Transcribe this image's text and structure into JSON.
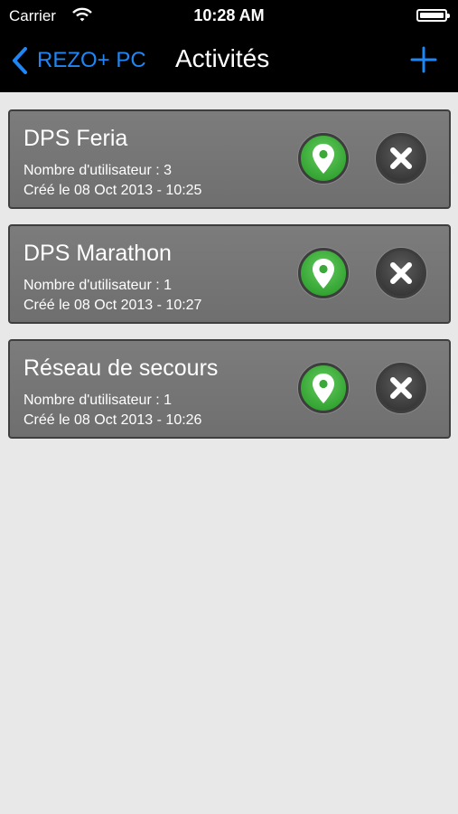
{
  "status_bar": {
    "carrier": "Carrier",
    "time": "10:28 AM",
    "icons": [
      "wifi-icon",
      "battery-icon"
    ]
  },
  "nav": {
    "back_label": "REZO+ PC",
    "title": "Activités",
    "accent_color": "#1e86f5",
    "icons": [
      "chevron-left-icon",
      "plus-icon"
    ]
  },
  "activities": [
    {
      "title": "DPS Feria",
      "users": "Nombre d'utilisateur : 3",
      "created": "Créé le 08 Oct 2013 - 10:25"
    },
    {
      "title": "DPS Marathon",
      "users": "Nombre d'utilisateur : 1",
      "created": "Créé le 08 Oct 2013 - 10:27"
    },
    {
      "title": "Réseau de secours",
      "users": "Nombre d'utilisateur : 1",
      "created": "Créé le 08 Oct 2013 - 10:26"
    }
  ],
  "card_icons": [
    "map-pin-icon",
    "close-icon"
  ],
  "colors": {
    "map_button": "#35a534",
    "delete_button": "#3a3a3a",
    "card_background": "#757575"
  }
}
